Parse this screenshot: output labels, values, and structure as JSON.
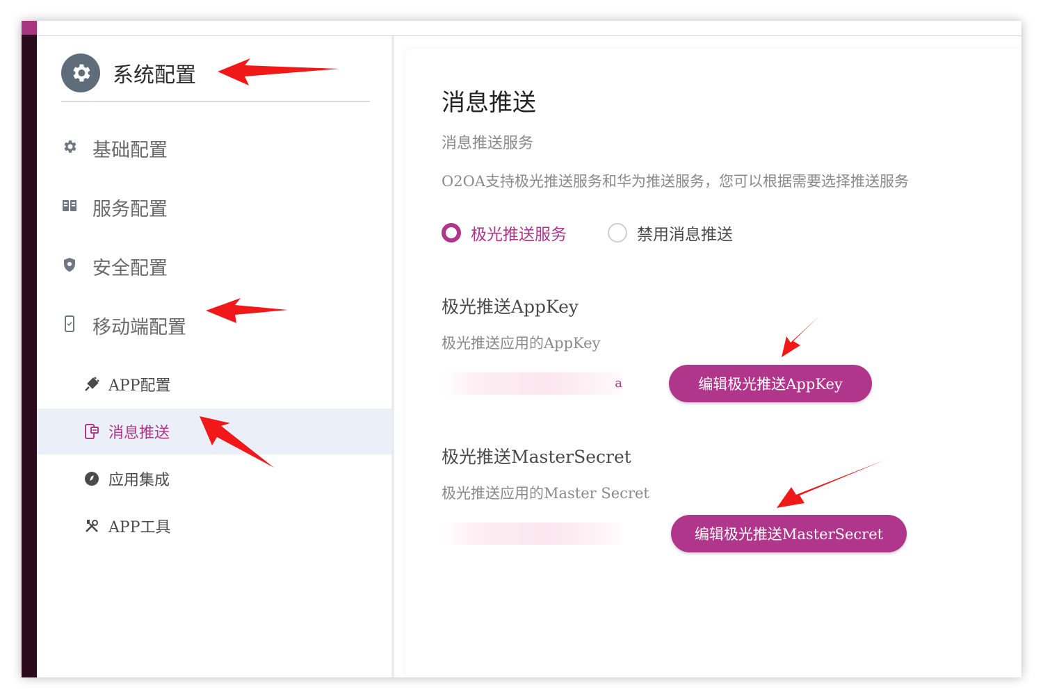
{
  "sidebar": {
    "header": {
      "title": "系统配置",
      "icon": "gear-icon"
    },
    "items": [
      {
        "label": "基础配置",
        "icon": "gear-icon"
      },
      {
        "label": "服务配置",
        "icon": "server-icon"
      },
      {
        "label": "安全配置",
        "icon": "shield-icon"
      },
      {
        "label": "移动端配置",
        "icon": "mobile-icon"
      }
    ],
    "subitems": [
      {
        "label": "APP配置",
        "icon": "plug-icon"
      },
      {
        "label": "消息推送",
        "icon": "push-icon",
        "active": true
      },
      {
        "label": "应用集成",
        "icon": "compass-icon"
      },
      {
        "label": "APP工具",
        "icon": "tools-icon"
      }
    ]
  },
  "content": {
    "title": "消息推送",
    "subtitle": "消息推送服务",
    "description": "O2OA支持极光推送服务和华为推送服务，您可以根据需要选择推送服务",
    "radios": [
      {
        "label": "极光推送服务",
        "checked": true
      },
      {
        "label": "禁用消息推送",
        "checked": false
      }
    ],
    "appkey": {
      "title": "极光推送AppKey",
      "desc": "极光推送应用的AppKey",
      "value_visible": "a",
      "button": "编辑极光推送AppKey"
    },
    "mastersecret": {
      "title": "极光推送MasterSecret",
      "desc": "极光推送应用的Master Secret",
      "value_visible": "",
      "button": "编辑极光推送MasterSecret"
    }
  },
  "colors": {
    "accent": "#b0368c",
    "arrow": "#f01818",
    "active_bg": "#ebf0f8",
    "strip": "#2a0a1c"
  }
}
